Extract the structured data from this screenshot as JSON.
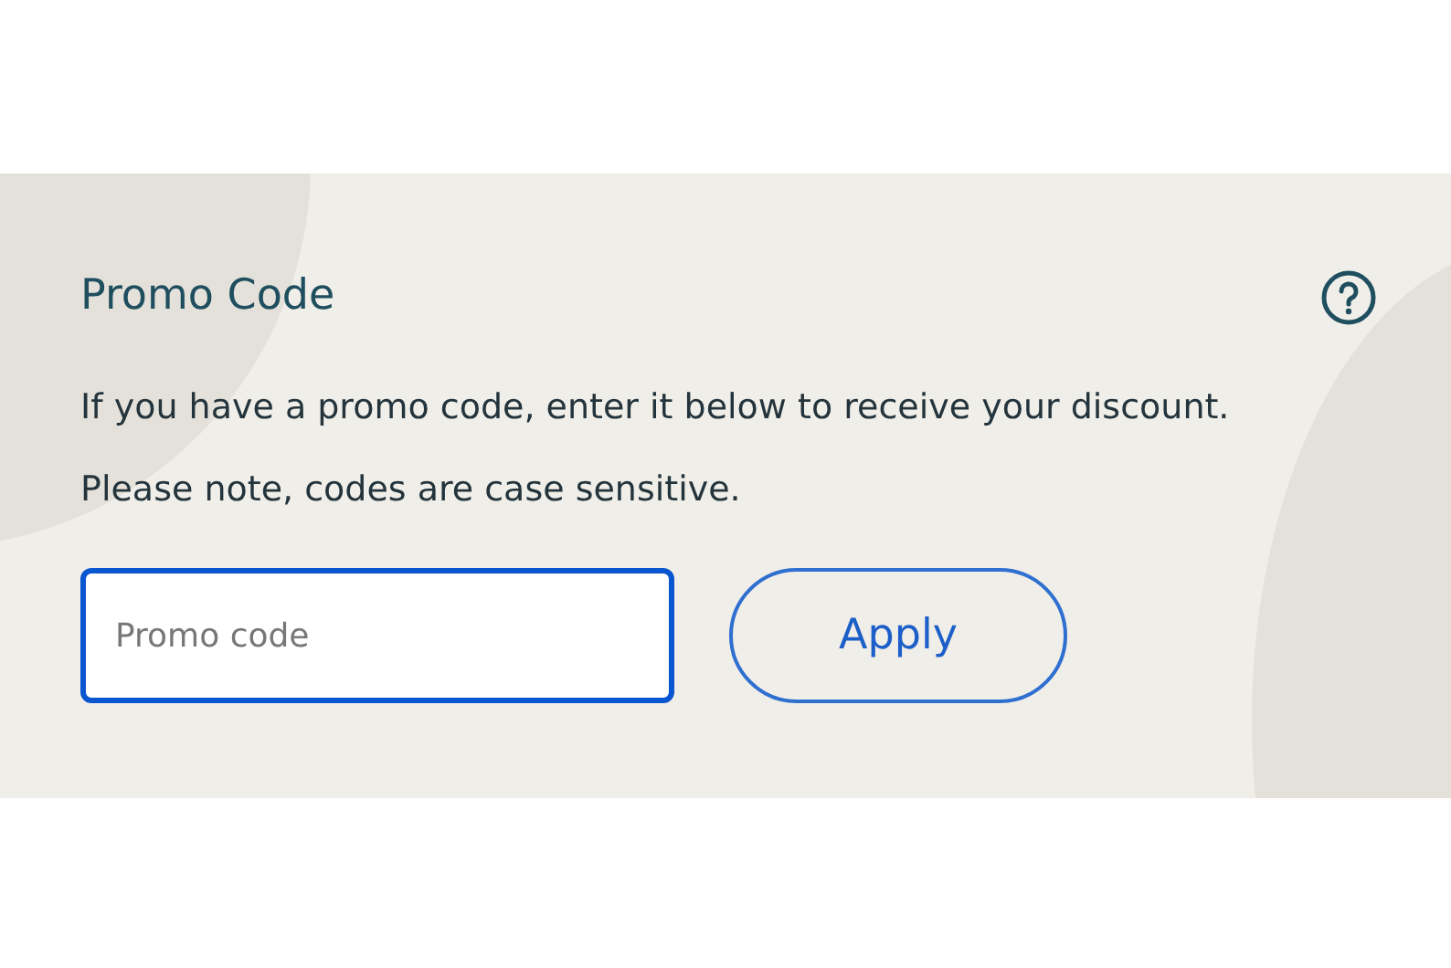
{
  "promo": {
    "title": "Promo Code",
    "description": "If you have a promo code, enter it below to receive your discount. Please note, codes are case sensitive.",
    "input": {
      "placeholder": "Promo code",
      "focused": true
    },
    "button": {
      "label": "Apply"
    }
  }
}
